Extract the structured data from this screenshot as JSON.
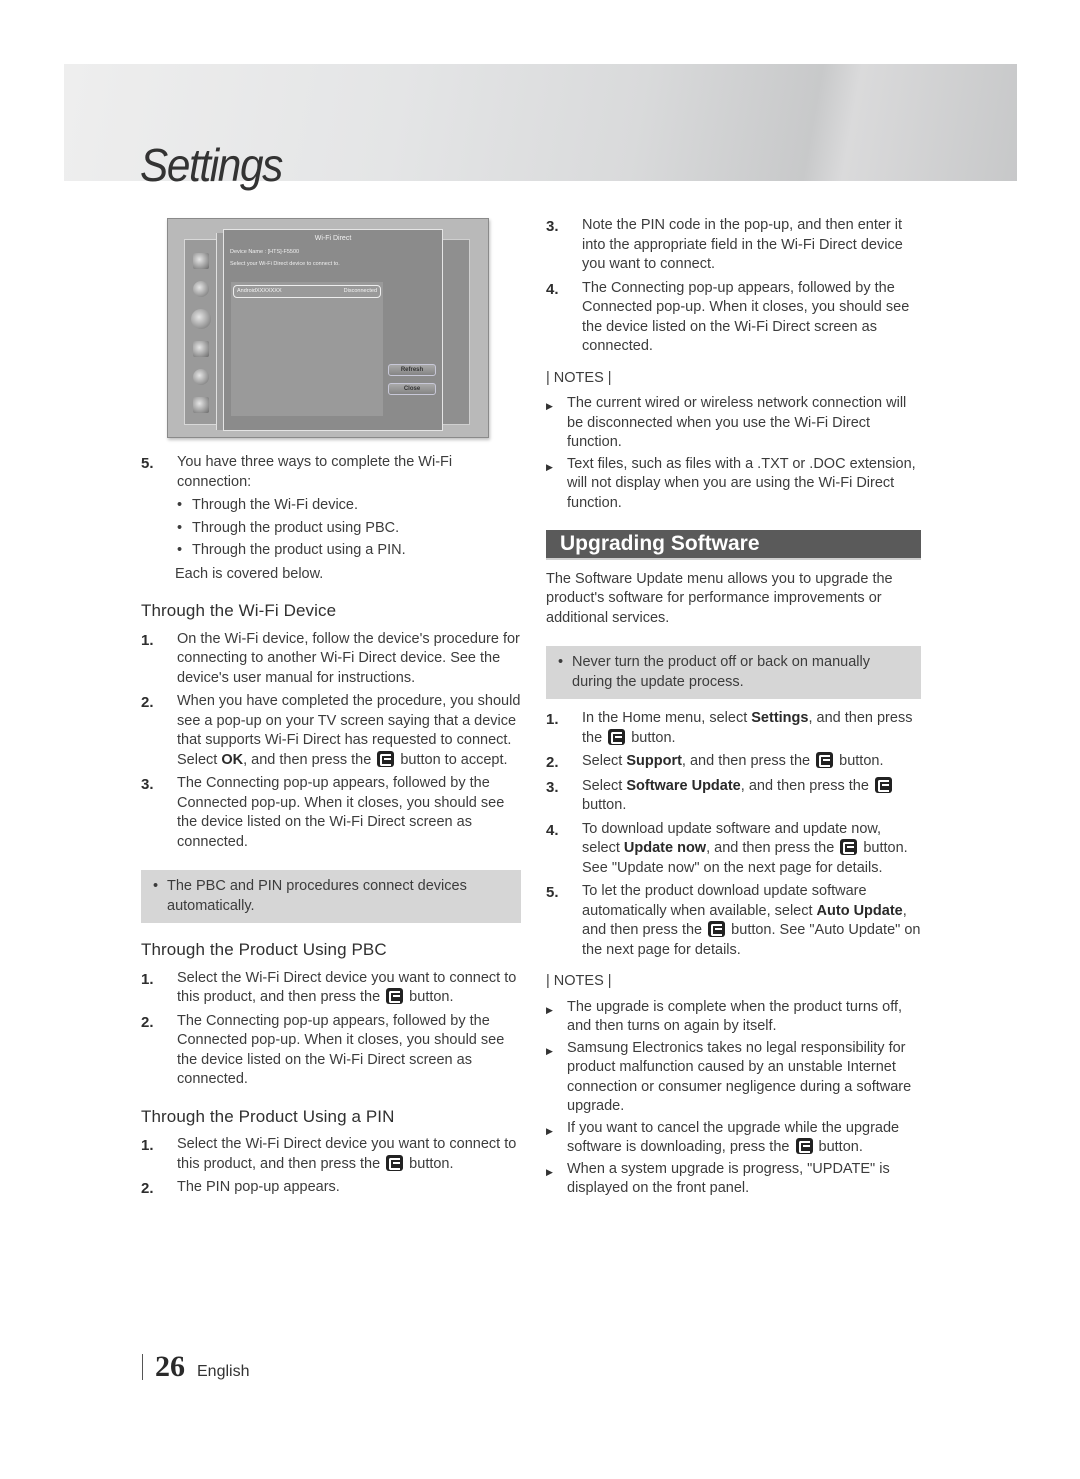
{
  "header": {
    "title": "Settings"
  },
  "tv_screen": {
    "dialog_title": "Wi-Fi Direct",
    "device_name": "Device Name : [HTS]-F5500",
    "instruction": "Select your Wi-Fi Direct device to connect to.",
    "device_list": [
      {
        "name": "AndroidXXXXXXX",
        "status": "Disconnected"
      }
    ],
    "buttons": {
      "refresh": "Refresh",
      "close": "Close"
    },
    "side_icons": [
      "network-icon",
      "speaker-icon",
      "globe-icon",
      "box-icon",
      "gear-icon",
      "help-icon"
    ]
  },
  "left": {
    "step5": {
      "num": "5.",
      "text": "You have three ways to complete the Wi-Fi connection:",
      "bullets": [
        "Through the Wi-Fi device.",
        "Through the product using PBC.",
        "Through the product using a PIN."
      ],
      "after": "Each is covered below."
    },
    "wifi_device": {
      "heading": "Through the Wi-Fi Device",
      "steps": [
        {
          "num": "1.",
          "text": "On the Wi-Fi device, follow the device's procedure for connecting to another Wi-Fi Direct device. See the device's user manual for instructions."
        },
        {
          "num": "2.",
          "pre": "When you have completed the procedure, you should see a pop-up on your TV screen saying that a device that supports Wi-Fi Direct has requested to connect. Select ",
          "bold": "OK",
          "mid": ", and then press the ",
          "post": " button to accept."
        },
        {
          "num": "3.",
          "text": "The Connecting pop-up appears, followed by the Connected pop-up. When it closes, you should see the device listed on the Wi-Fi Direct screen as connected."
        }
      ],
      "note": "The PBC and PIN procedures connect devices automatically."
    },
    "pbc": {
      "heading": "Through the Product Using PBC",
      "steps": [
        {
          "num": "1.",
          "pre": "Select the Wi-Fi Direct device you want to connect to this product, and then press the ",
          "post": " button."
        },
        {
          "num": "2.",
          "text": "The Connecting pop-up appears, followed by the Connected pop-up. When it closes, you should see the device listed on the Wi-Fi Direct screen as connected."
        }
      ]
    },
    "pin": {
      "heading": "Through the Product Using a PIN",
      "steps": [
        {
          "num": "1.",
          "pre": "Select the Wi-Fi Direct device you want to connect to this product, and then press the ",
          "post": " button."
        },
        {
          "num": "2.",
          "text": "The PIN pop-up appears."
        }
      ]
    }
  },
  "right": {
    "pin_steps": [
      {
        "num": "3.",
        "text": "Note the PIN code in the pop-up, and then enter it into the appropriate field in the Wi-Fi Direct device you want to connect."
      },
      {
        "num": "4.",
        "text": "The Connecting pop-up appears, followed by the Connected pop-up. When it closes, you should see the device listed on the Wi-Fi Direct screen as connected."
      }
    ],
    "notes1": {
      "title": "| NOTES |",
      "items": [
        "The current wired or wireless network connection will be disconnected when you use the Wi-Fi Direct function.",
        "Text files, such as files with a .TXT or .DOC extension, will not display when you are using the Wi-Fi Direct function."
      ]
    },
    "upgrade": {
      "heading": "Upgrading Software",
      "intro": "The Software Update menu allows you to upgrade the product's software for performance improvements or additional services.",
      "warning": "Never turn the product off or back on manually during the update process.",
      "steps": [
        {
          "num": "1.",
          "pre": "In the Home menu, select ",
          "bold": "Settings",
          "mid": ", and then press the ",
          "post": " button."
        },
        {
          "num": "2.",
          "pre": "Select ",
          "bold": "Support",
          "mid": ", and then press the ",
          "post": " button."
        },
        {
          "num": "3.",
          "pre": "Select ",
          "bold": "Software Update",
          "mid": ", and then press the ",
          "post": " button."
        },
        {
          "num": "4.",
          "pre": "To download update software and update now, select ",
          "bold": "Update now",
          "mid": ", and then press the ",
          "post": " button. See \"Update now\" on the next page for details."
        },
        {
          "num": "5.",
          "pre": "To let the product download update software automatically when available, select ",
          "bold": "Auto Update",
          "mid": ", and then press the ",
          "post": " button. See \"Auto Update\" on the next page for details."
        }
      ]
    },
    "notes2": {
      "title": "| NOTES |",
      "items": [
        {
          "text": "The upgrade is complete when the product turns off, and then turns on again by itself."
        },
        {
          "text": "Samsung Electronics takes no legal responsibility for product malfunction caused by an unstable Internet connection or consumer negligence during a software upgrade."
        },
        {
          "pre": "If you want to cancel the upgrade while the upgrade software is downloading, press the ",
          "post": " button."
        },
        {
          "text": "When a system upgrade is progress, \"UPDATE\" is displayed on the front panel."
        }
      ]
    }
  },
  "footer": {
    "page_number": "26",
    "language": "English"
  },
  "colors": {
    "section_bar": "#5a5a5a",
    "note_box": "#d6d6d6",
    "text": "#3c3c3c"
  }
}
